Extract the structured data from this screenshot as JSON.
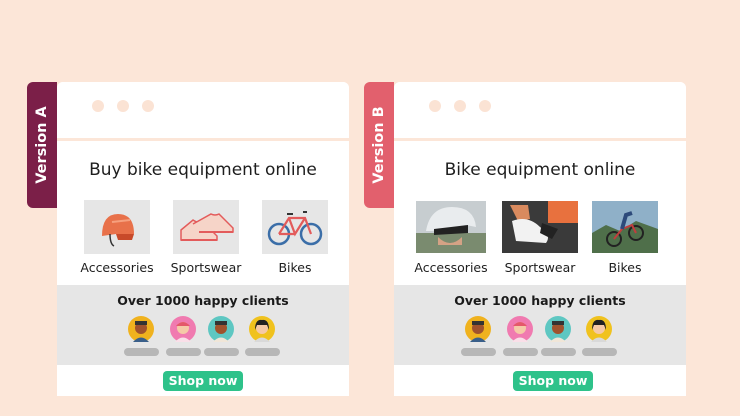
{
  "version_a": {
    "tag": "Version A",
    "headline": "Buy bike equipment online",
    "products": [
      {
        "label": "Accessories",
        "icon": "helmet-icon"
      },
      {
        "label": "Sportswear",
        "icon": "sneakers-icon"
      },
      {
        "label": "Bikes",
        "icon": "bicycle-icon"
      }
    ],
    "clients_text": "Over 1000 happy clients",
    "cta": "Shop now"
  },
  "version_b": {
    "tag": "Version B",
    "headline": "Bike equipment online",
    "products": [
      {
        "label": "Accessories",
        "image": "helmet-photo"
      },
      {
        "label": "Sportswear",
        "image": "cycling-shoes-photo"
      },
      {
        "label": "Bikes",
        "image": "mountain-bike-photo"
      }
    ],
    "clients_text": "Over 1000 happy clients",
    "cta": "Shop now"
  },
  "colors": {
    "background": "#fce6d8",
    "tag_a": "#7b1f48",
    "tag_b": "#e2606d",
    "cta": "#2ec28a",
    "section_gray": "#e6e6e6"
  }
}
